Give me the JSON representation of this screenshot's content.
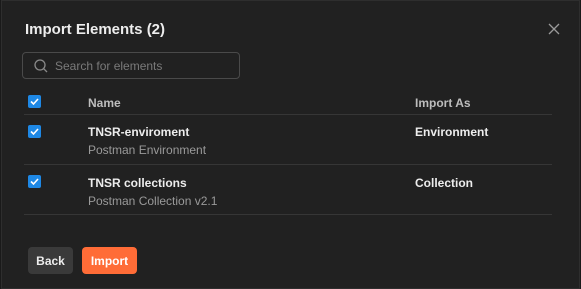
{
  "dialog": {
    "title": "Import Elements (2)"
  },
  "search": {
    "placeholder": "Search for elements",
    "value": ""
  },
  "table": {
    "headers": {
      "name": "Name",
      "import_as": "Import As"
    },
    "rows": [
      {
        "name": "TNSR-enviroment",
        "type": "Postman Environment",
        "import_as": "Environment",
        "checked": true
      },
      {
        "name": "TNSR collections",
        "type": "Postman Collection v2.1",
        "import_as": "Collection",
        "checked": true
      }
    ]
  },
  "buttons": {
    "back": "Back",
    "import": "Import"
  },
  "colors": {
    "checkbox": "#1e88e5",
    "primary_button": "#ff6c37",
    "background": "#212121"
  }
}
